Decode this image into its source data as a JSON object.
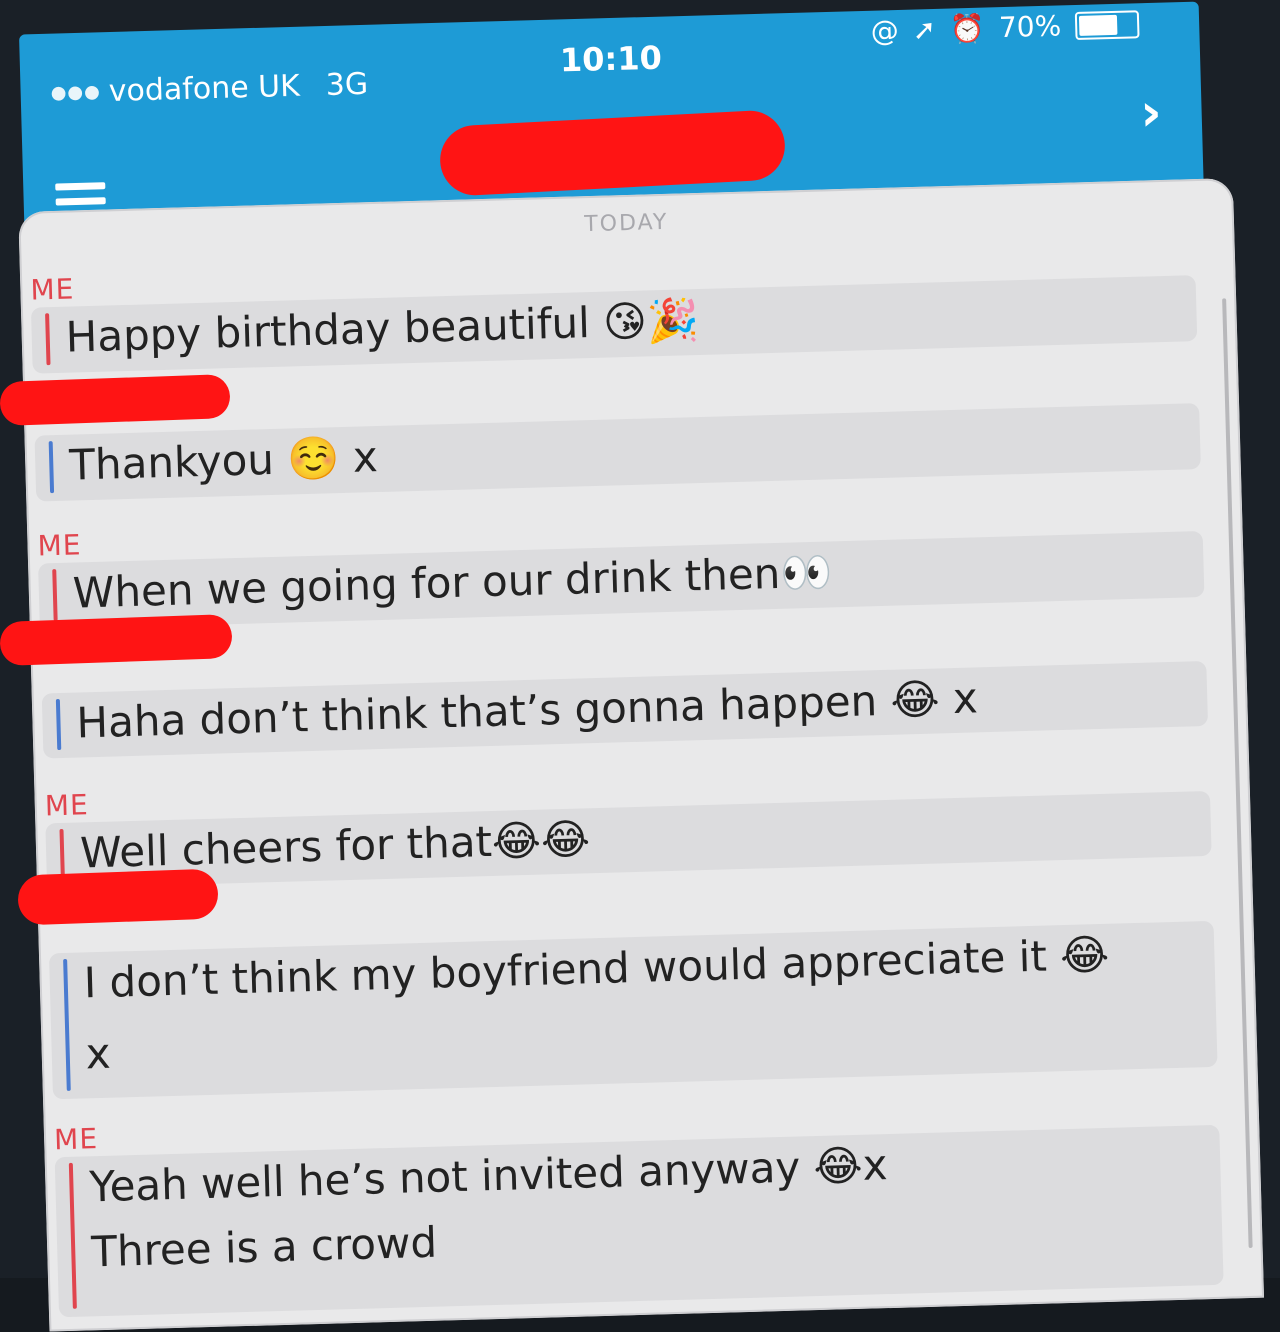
{
  "status_bar": {
    "carrier": "vodafone UK",
    "network": "3G",
    "time": "10:10",
    "battery": "70%",
    "battery_level": 0.7
  },
  "chat": {
    "date_label": "TODAY",
    "messages": [
      {
        "sender": "ME",
        "lines": [
          "Happy birthday beautiful 😘🎉"
        ]
      },
      {
        "sender": "",
        "lines": [
          "Thankyou ☺️ x"
        ]
      },
      {
        "sender": "ME",
        "lines": [
          "When we going for our drink then👀"
        ]
      },
      {
        "sender": "",
        "lines": [
          "Haha don’t think that’s gonna happen 😂 x"
        ]
      },
      {
        "sender": "ME",
        "lines": [
          "Well cheers for that😂😂"
        ]
      },
      {
        "sender": "",
        "lines": [
          "I don’t think my boyfriend would appreciate it 😂",
          "x"
        ]
      },
      {
        "sender": "ME",
        "lines": [
          "Yeah well he’s not invited anyway 😂x",
          "Three is a crowd"
        ]
      }
    ]
  },
  "icons": {
    "menu": "menu-icon",
    "forward": "chevron-right-icon",
    "location": "location-arrow-icon",
    "alarm": "alarm-icon",
    "at": "at-icon"
  },
  "colors": {
    "header": "#1e9bd6",
    "me_bar": "#e0454e",
    "them_bar": "#4a7bd0",
    "redaction": "#ff1414"
  }
}
